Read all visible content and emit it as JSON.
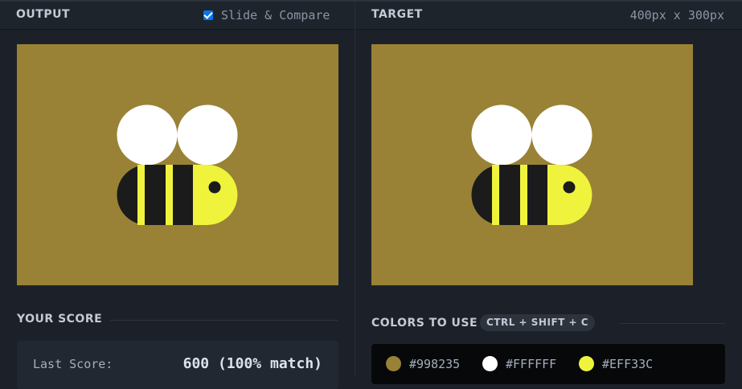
{
  "output": {
    "title": "OUTPUT",
    "slide_compare_label": "Slide & Compare",
    "slide_compare_checked": true
  },
  "target": {
    "title": "TARGET",
    "dimensions": "400px x 300px"
  },
  "score": {
    "heading": "YOUR SCORE",
    "last_label": "Last Score:",
    "last_value": "600 (100% match)"
  },
  "colors": {
    "heading": "COLORS TO USE",
    "shortcut": "CTRL + SHIFT + C",
    "swatches": [
      {
        "hex": "#998235",
        "label": "#998235"
      },
      {
        "hex": "#FFFFFF",
        "label": "#FFFFFF"
      },
      {
        "hex": "#EFF33C",
        "label": "#EFF33C"
      }
    ]
  },
  "theme": {
    "background": "#998235",
    "wing": "#FFFFFF",
    "yellow": "#EFF33C",
    "dark": "#1b1b1b"
  }
}
